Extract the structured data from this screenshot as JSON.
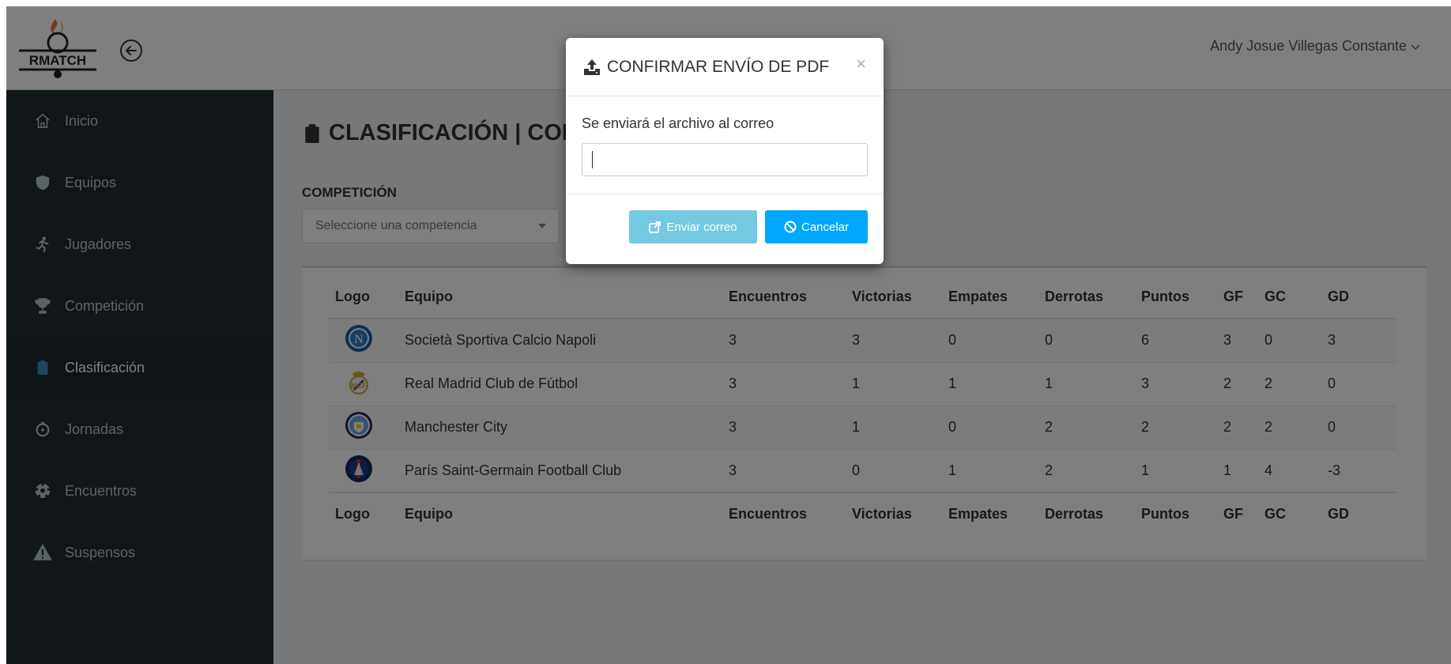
{
  "app": {
    "logo_text": "RMATCH"
  },
  "header": {
    "user_name": "Andy Josue Villegas Constante"
  },
  "sidebar": {
    "items": [
      {
        "label": "Inicio",
        "icon": "home-icon"
      },
      {
        "label": "Equipos",
        "icon": "shield-icon"
      },
      {
        "label": "Jugadores",
        "icon": "running-icon"
      },
      {
        "label": "Competición",
        "icon": "trophy-icon"
      },
      {
        "label": "Clasificación",
        "icon": "clipboard-icon",
        "active": true
      },
      {
        "label": "Jornadas",
        "icon": "clock-icon"
      },
      {
        "label": "Encuentros",
        "icon": "soccer-ball-icon"
      },
      {
        "label": "Suspensos",
        "icon": "warning-icon"
      }
    ]
  },
  "main": {
    "title": "CLASIFICACIÓN | COM",
    "competition_label": "COMPETICIÓN",
    "competition_select": {
      "placeholder": "Seleccione una competencia"
    },
    "table": {
      "columns": [
        "Logo",
        "Equipo",
        "Encuentros",
        "Victorias",
        "Empates",
        "Derrotas",
        "Puntos",
        "GF",
        "GC",
        "GD"
      ],
      "rows": [
        {
          "team": "Società Sportiva Calcio Napoli",
          "logo": "napoli-logo",
          "values": [
            "3",
            "3",
            "0",
            "0",
            "6",
            "3",
            "0",
            "3"
          ]
        },
        {
          "team": "Real Madrid Club de Fútbol",
          "logo": "real-madrid-logo",
          "values": [
            "3",
            "1",
            "1",
            "1",
            "3",
            "2",
            "2",
            "0"
          ]
        },
        {
          "team": "Manchester City",
          "logo": "manchester-city-logo",
          "values": [
            "3",
            "1",
            "0",
            "2",
            "2",
            "2",
            "2",
            "0"
          ]
        },
        {
          "team": "París Saint-Germain Football Club",
          "logo": "psg-logo",
          "values": [
            "3",
            "0",
            "1",
            "2",
            "1",
            "1",
            "4",
            "-3"
          ]
        }
      ]
    }
  },
  "modal": {
    "title": "CONFIRMAR ENVÍO DE PDF",
    "close_glyph": "×",
    "message": "Se enviará el archivo al correo",
    "email_value": "",
    "send_label": "Enviar correo",
    "cancel_label": "Cancelar"
  },
  "colors": {
    "sidebar_bg": "#222d32",
    "content_bg": "#ecf0f5",
    "send_button": "#5bc0de",
    "cancel_button": "#00a7ff"
  }
}
